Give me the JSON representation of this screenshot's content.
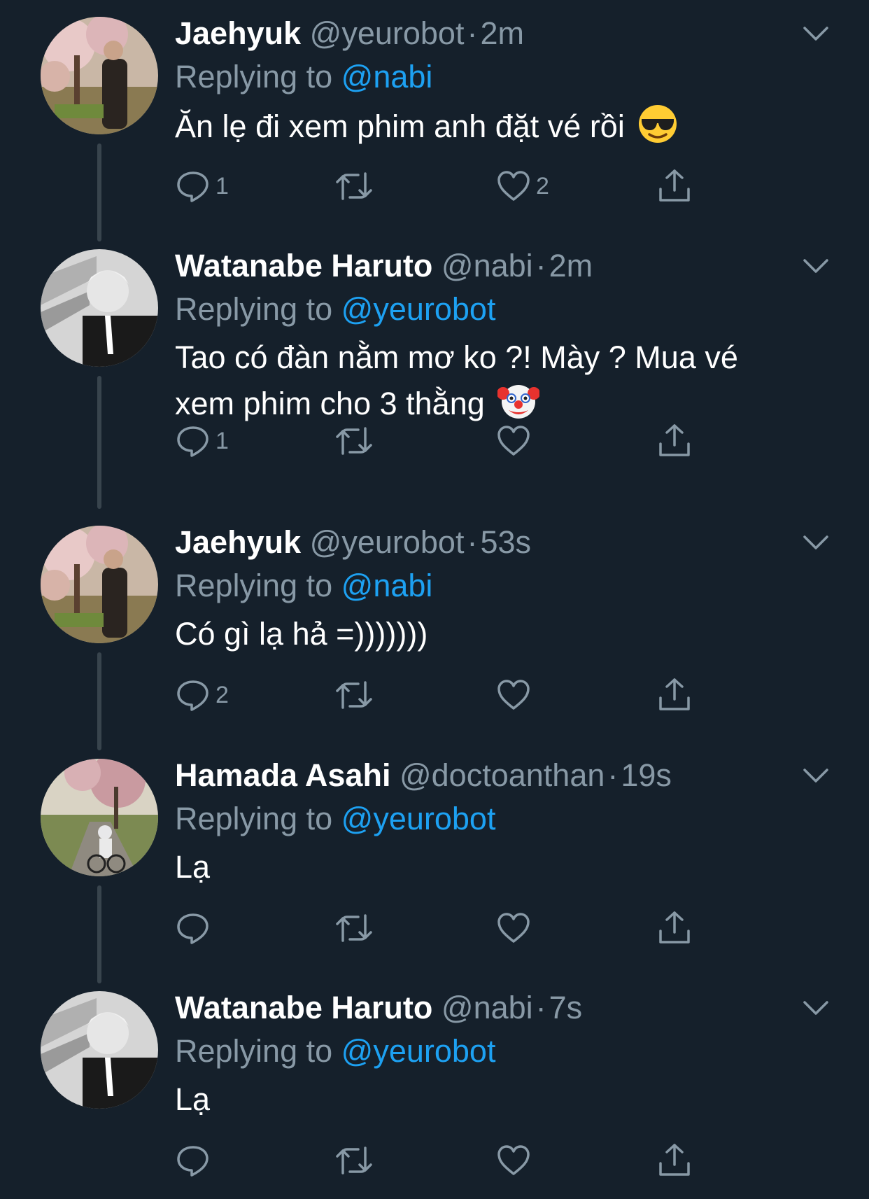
{
  "tweets": [
    {
      "name": "Jaehyuk",
      "handle": "@yeurobot",
      "separator": "·",
      "time": "2m",
      "replying_label": "Replying to",
      "replying_to": "@nabi",
      "text": "Ăn lẹ đi xem phim anh đặt vé rồi",
      "emoji": "smiling-face-with-sunglasses",
      "reply_count": "1",
      "retweet_count": "",
      "like_count": "2",
      "avatar": "cherry-blossom-portrait"
    },
    {
      "name": "Watanabe Haruto",
      "handle": "@nabi",
      "separator": "·",
      "time": "2m",
      "replying_label": "Replying to",
      "replying_to": "@yeurobot",
      "text": "Tao có đàn nằm mơ ko ?! Mày ? Mua vé xem phim cho 3 thằng",
      "emoji": "clown-face",
      "reply_count": "1",
      "retweet_count": "",
      "like_count": "",
      "avatar": "monochrome-portrait"
    },
    {
      "name": "Jaehyuk",
      "handle": "@yeurobot",
      "separator": "·",
      "time": "53s",
      "replying_label": "Replying to",
      "replying_to": "@nabi",
      "text": "Có gì lạ hả =)))))))",
      "emoji": "",
      "reply_count": "2",
      "retweet_count": "",
      "like_count": "",
      "avatar": "cherry-blossom-portrait"
    },
    {
      "name": "Hamada Asahi",
      "handle": "@doctoanthan",
      "separator": "·",
      "time": "19s",
      "replying_label": "Replying to",
      "replying_to": "@yeurobot",
      "text": "Lạ",
      "emoji": "",
      "reply_count": "",
      "retweet_count": "",
      "like_count": "",
      "avatar": "bicycle-park-photo"
    },
    {
      "name": "Watanabe Haruto",
      "handle": "@nabi",
      "separator": "·",
      "time": "7s",
      "replying_label": "Replying to",
      "replying_to": "@yeurobot",
      "text": "Lạ",
      "emoji": "",
      "reply_count": "",
      "retweet_count": "",
      "like_count": "",
      "avatar": "monochrome-portrait"
    }
  ],
  "colors": {
    "background": "#15202b",
    "primary_text": "#ffffff",
    "secondary_text": "#8899a6",
    "accent": "#1da1f2",
    "thread_line": "#38444d"
  }
}
